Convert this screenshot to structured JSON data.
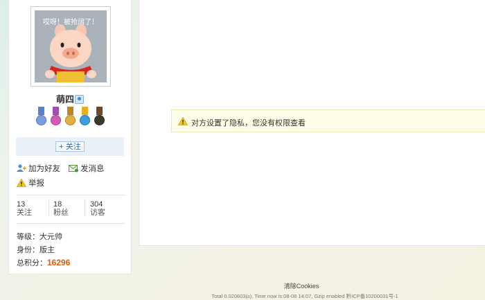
{
  "avatar": {
    "caption": "哎呀！被抢阔了！"
  },
  "profile": {
    "username": "萌四"
  },
  "medals": [
    {
      "icon": "medal-blue-icon",
      "ribbon": "#5b7fc4",
      "disc": "#7a9de0"
    },
    {
      "icon": "medal-purple-icon",
      "ribbon": "#a04fb0",
      "disc": "#d65ab8"
    },
    {
      "icon": "medal-gold-cross-icon",
      "ribbon": "#b8862a",
      "disc": "#e0b040"
    },
    {
      "icon": "medal-doraemon-icon",
      "ribbon": "#e6b020",
      "disc": "#3a9ee0"
    },
    {
      "icon": "medal-iron-cross-icon",
      "ribbon": "#6b4a2a",
      "disc": "#3a3a2a"
    }
  ],
  "follow": {
    "label": "+ 关注"
  },
  "actions": {
    "add_friend": "加为好友",
    "send_message": "发消息",
    "report": "举报"
  },
  "stats": [
    {
      "value": "13",
      "label": "关注"
    },
    {
      "value": "18",
      "label": "粉丝"
    },
    {
      "value": "304",
      "label": "访客"
    }
  ],
  "info": {
    "level_label": "等级：",
    "level_value": "大元帅",
    "role_label": "身份：",
    "role_value": "版主",
    "points_label": "总积分：",
    "points_value": "16296"
  },
  "notice": {
    "text": "对方设置了隐私，您没有权限查看"
  },
  "footer": {
    "clear_cookies": "清除Cookies",
    "info": "Total 0.020603(s), Time now is:08-08 14:07, Gzip enabled 黔ICP备10200031号-1"
  }
}
